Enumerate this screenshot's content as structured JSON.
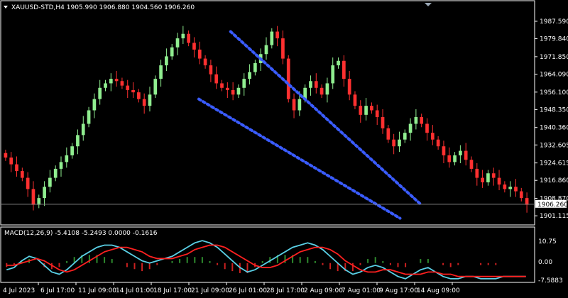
{
  "header": {
    "symbol_line": "XAUUSD-STD,H4  1905.990 1906.880 1904.560 1906.260"
  },
  "macd": {
    "label": "MACD(12,26,9) -5.4108 -5.2493 0.0000 -0.1616",
    "levels": [
      "10.75",
      "0.00",
      "-7.5883"
    ]
  },
  "colors": {
    "background": "#000000",
    "bull_candle": "#90ee90",
    "bear_candle": "#ff3030",
    "trendline": "#3a5cff",
    "macd_line": "#5ad0e6",
    "signal_line": "#ff2020",
    "hist_pos": "#2e8b2e",
    "hist_neg": "#cc2020",
    "axis": "#ffffff",
    "grid_box": "#ffffff"
  },
  "chart_data": {
    "type": "candlestick",
    "title": "XAUUSD-STD,H4",
    "ylim": [
      1898.0,
      1992.0
    ],
    "price_ticks": [
      "1987.590",
      "1979.840",
      "1971.850",
      "1964.090",
      "1956.100",
      "1948.350",
      "1940.360",
      "1932.605",
      "1924.615",
      "1916.860",
      "1908.870",
      "1901.115"
    ],
    "current_price": "1906.260",
    "x_labels": [
      "4 Jul 2023",
      "6 Jul 17:00",
      "11 Jul 09:00",
      "14 Jul 01:00",
      "18 Jul 17:00",
      "21 Jul 09:00",
      "26 Jul 01:00",
      "28 Jul 17:00",
      "2 Aug 09:00",
      "7 Aug 01:00",
      "9 Aug 17:00",
      "14 Aug 09:00"
    ],
    "close_path": [
      1927,
      1924,
      1921,
      1918,
      1913,
      1906,
      1909,
      1914,
      1918,
      1922,
      1925,
      1928,
      1932,
      1937,
      1942,
      1948,
      1953,
      1958,
      1960,
      1962,
      1961,
      1959,
      1957,
      1956,
      1953,
      1950,
      1955,
      1962,
      1968,
      1972,
      1976,
      1980,
      1982,
      1978,
      1975,
      1971,
      1968,
      1964,
      1960,
      1958,
      1957,
      1955,
      1958,
      1962,
      1965,
      1969,
      1973,
      1977,
      1983,
      1980,
      1971,
      1953,
      1948,
      1953,
      1958,
      1961,
      1958,
      1955,
      1960,
      1968,
      1970,
      1962,
      1955,
      1950,
      1946,
      1950,
      1948,
      1945,
      1940,
      1935,
      1932,
      1935,
      1938,
      1942,
      1945,
      1942,
      1938,
      1935,
      1932,
      1928,
      1925,
      1928,
      1930,
      1926,
      1922,
      1918,
      1916,
      1920,
      1918,
      1915,
      1913,
      1914,
      1912,
      1909,
      1906
    ],
    "trendlines": [
      {
        "name": "upper",
        "points": [
          [
            0.43,
            1983
          ],
          [
            0.79,
            1906
          ]
        ]
      },
      {
        "name": "lower",
        "points": [
          [
            0.37,
            1953
          ],
          [
            0.75,
            1900
          ]
        ]
      }
    ],
    "macd_series": {
      "macd": [
        -3,
        -2,
        1,
        3,
        2,
        -1,
        -4,
        -5,
        -3,
        0,
        3,
        5,
        7,
        8,
        8,
        7,
        5,
        3,
        1,
        0,
        1,
        2,
        3,
        5,
        7,
        9,
        10,
        9,
        7,
        4,
        1,
        -2,
        -4,
        -3,
        -1,
        1,
        3,
        5,
        7,
        8,
        9,
        8,
        6,
        3,
        0,
        -3,
        -5,
        -4,
        -2,
        -1,
        -2,
        -4,
        -6,
        -7,
        -5,
        -3,
        -2,
        -4,
        -6,
        -7,
        -7,
        -6,
        -6,
        -7,
        -7,
        -7,
        -6,
        -6,
        -6,
        -6
      ],
      "signal": [
        -1,
        -1,
        0,
        1,
        2,
        1,
        -1,
        -3,
        -4,
        -3,
        -1,
        1,
        3,
        5,
        6,
        7,
        7,
        6,
        5,
        3,
        2,
        2,
        2,
        3,
        4,
        6,
        7,
        8,
        8,
        7,
        5,
        3,
        1,
        -1,
        -2,
        -2,
        -1,
        1,
        3,
        5,
        6,
        7,
        7,
        6,
        4,
        1,
        -1,
        -3,
        -4,
        -4,
        -3,
        -3,
        -4,
        -5,
        -5,
        -5,
        -4,
        -4,
        -5,
        -5,
        -6,
        -6,
        -6,
        -6,
        -6,
        -6,
        -6,
        -6,
        -6,
        -6
      ]
    }
  }
}
